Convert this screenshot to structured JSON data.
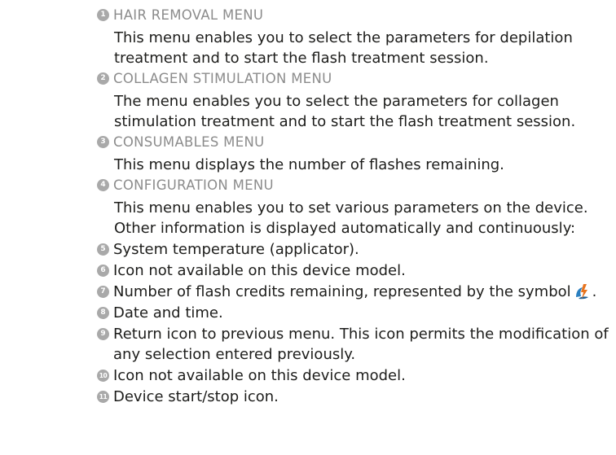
{
  "sections": [
    {
      "number": "1",
      "title": "HAIR REMOVAL MENU",
      "lines": [
        "This menu enables you to select the parameters for depilation",
        "treatment and to start the flash treatment session."
      ]
    },
    {
      "number": "2",
      "title": "COLLAGEN STIMULATION MENU",
      "lines": [
        "The menu enables you to select the parameters for collagen",
        "stimulation treatment and to start the flash treatment session."
      ]
    },
    {
      "number": "3",
      "title": "CONSUMABLES MENU",
      "lines": [
        "This menu displays the number of flashes remaining."
      ]
    },
    {
      "number": "4",
      "title": "CONFIGURATION MENU",
      "lines": [
        "This menu enables you to set various parameters on the device.",
        "Other information is displayed automatically and continuously:"
      ]
    }
  ],
  "items": [
    {
      "number": "5",
      "text": "System temperature (applicator)."
    },
    {
      "number": "6",
      "text": "Icon not available on this device model."
    },
    {
      "number": "7",
      "text_before": "Number of flash credits remaining, represented by the symbol",
      "text_after": ".",
      "icon": "flash-credit-icon"
    },
    {
      "number": "8",
      "text": "Date and time."
    },
    {
      "number": "9",
      "text": "Return icon to previous menu. This icon permits the modification of",
      "continuation": "any selection entered previously."
    },
    {
      "number": "10",
      "text": "Icon not available on this device model."
    },
    {
      "number": "11",
      "text": "Device start/stop icon."
    }
  ],
  "colors": {
    "heading": "#8c8c8c",
    "body_text": "#1d1d1b",
    "number_badge": "#a9a9a9",
    "icon_blue": "#2a7fc0",
    "icon_orange": "#e8741e"
  }
}
